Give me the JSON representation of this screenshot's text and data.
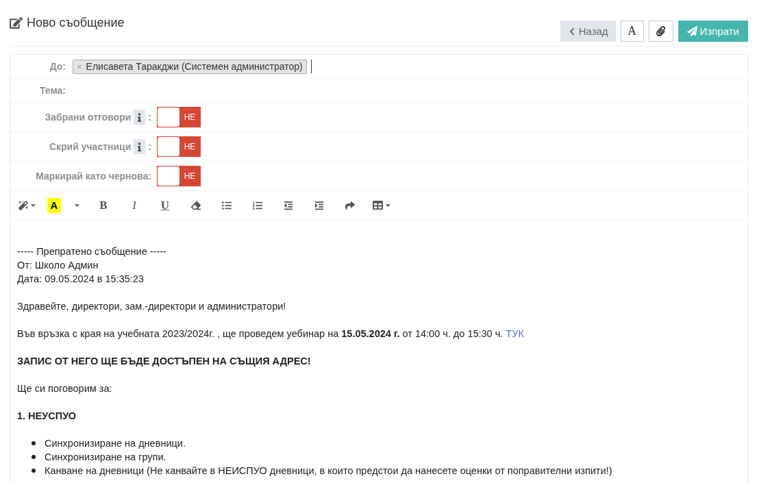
{
  "header": {
    "title": "Ново съобщение",
    "buttons": [
      {
        "kind": "back",
        "label": "Назад"
      },
      {
        "kind": "font",
        "label": "A"
      },
      {
        "kind": "attach"
      },
      {
        "kind": "send",
        "label": "Изпрати"
      }
    ]
  },
  "form": {
    "fields": [
      {
        "kind": "recipients",
        "label": "До:",
        "tags": [
          {
            "remove": "×",
            "text": "Елисавета Таракджи (Системен администратор)"
          }
        ]
      },
      {
        "kind": "subject",
        "label": "Тема:"
      },
      {
        "kind": "toggle",
        "label": "Забрани отговори",
        "info": true,
        "colon": ":",
        "on": false,
        "state_text": "НЕ"
      },
      {
        "kind": "toggle",
        "label": "Скрий участници",
        "info": true,
        "colon": ":",
        "on": false,
        "state_text": "НЕ"
      },
      {
        "kind": "toggle",
        "label": "Маркирай като чернова",
        "info": false,
        "colon": ":",
        "on": false,
        "state_text": "НЕ"
      }
    ]
  },
  "editor": {
    "toolbar": [
      {
        "kind": "magic"
      },
      {
        "kind": "highlight",
        "label": "A"
      },
      {
        "kind": "caret"
      },
      {
        "kind": "bold",
        "label": "B"
      },
      {
        "kind": "italic",
        "label": "I"
      },
      {
        "kind": "underline",
        "label": "U"
      },
      {
        "kind": "eraser"
      },
      {
        "kind": "bullet-list"
      },
      {
        "kind": "numbered-list"
      },
      {
        "kind": "outdent"
      },
      {
        "kind": "indent"
      },
      {
        "kind": "redo"
      },
      {
        "kind": "table"
      }
    ],
    "body": [
      {
        "kind": "paragraph",
        "lines": [
          "----- Препратено съобщение -----",
          "От: Школо Админ",
          "Дата: 09.05.2024 в 15:35:23"
        ]
      },
      {
        "kind": "paragraph",
        "lines": [
          "Здравейте, директори, зам.-директори и администратори!"
        ]
      },
      {
        "kind": "paragraph",
        "lines": [
          "Във връзка с края на учебната 2023/2024г. , ще проведем уебинар на **15.05.2024 г.** от 14:00 ч. до 15:30 ч."
        ],
        "link": "ТУК"
      },
      {
        "kind": "heading",
        "text": "ЗАПИС ОТ НЕГО ЩЕ БЪДЕ ДОСТЪПЕН НА СЪЩИЯ АДРЕС!"
      },
      {
        "kind": "paragraph",
        "lines": [
          "Ще си поговорим за:"
        ]
      },
      {
        "kind": "heading",
        "text": "1. НЕУСПУО"
      },
      {
        "kind": "list",
        "items": [
          "Синхронизиране на дневници.",
          "Синхронизиране на групи.",
          "Канване на дневници (Не канвайте в НЕИСПУО дневници, в които предстои да нанесете оценки от поправителни изпити!)"
        ]
      }
    ]
  }
}
